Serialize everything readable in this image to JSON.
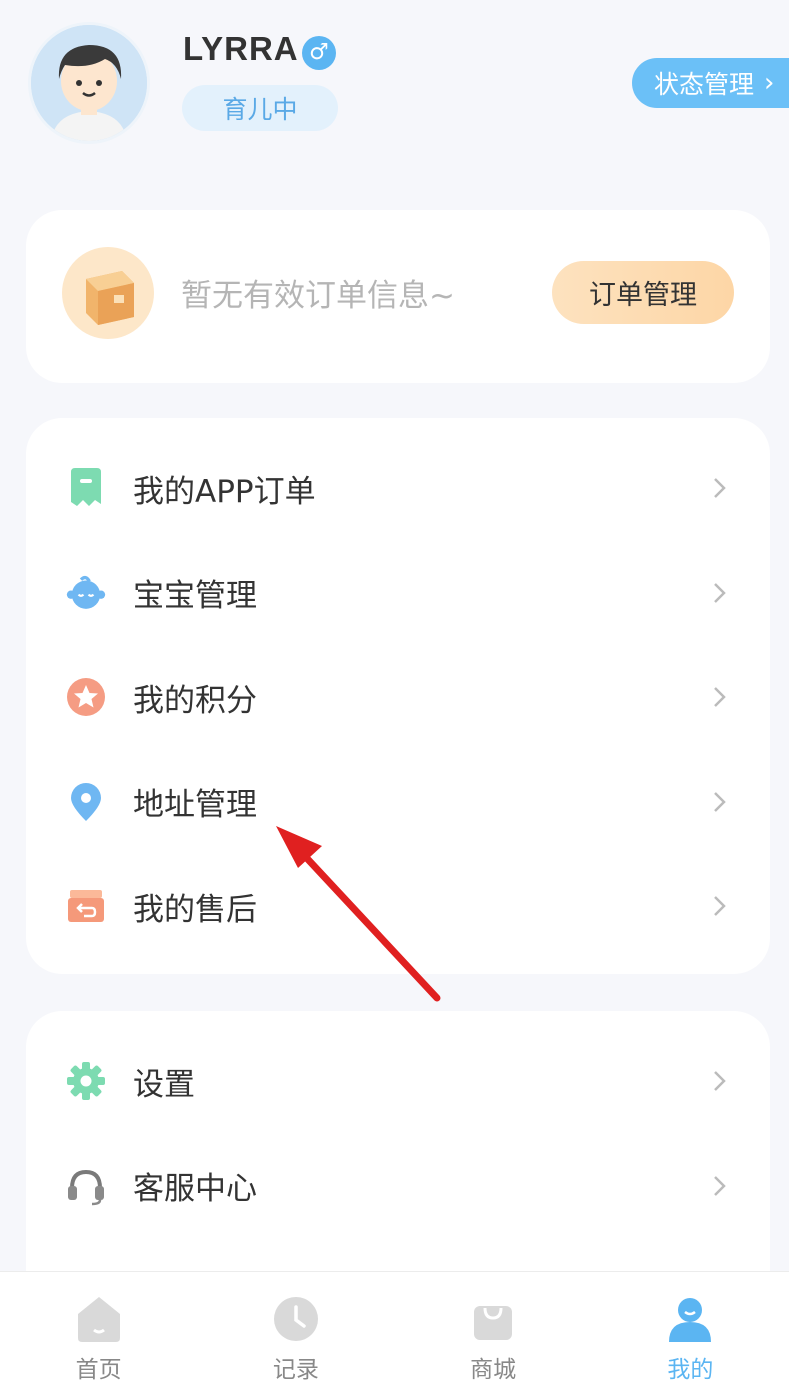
{
  "profile": {
    "username": "LYRRA",
    "gender_symbol": "♂",
    "status_badge": "育儿中",
    "state_button_label": "状态管理",
    "state_button_chevron": "›"
  },
  "order_card": {
    "empty_text": "暂无有效订单信息~",
    "manage_button": "订单管理"
  },
  "menu_group_1": [
    {
      "label": "我的APP订单",
      "icon": "order-receipt-icon"
    },
    {
      "label": "宝宝管理",
      "icon": "baby-face-icon"
    },
    {
      "label": "我的积分",
      "icon": "star-points-icon"
    },
    {
      "label": "地址管理",
      "icon": "location-pin-icon"
    },
    {
      "label": "我的售后",
      "icon": "return-box-icon"
    }
  ],
  "menu_group_2": [
    {
      "label": "设置",
      "icon": "gear-icon"
    },
    {
      "label": "客服中心",
      "icon": "headset-icon"
    }
  ],
  "tabbar": [
    {
      "label": "首页",
      "icon": "home-icon",
      "active": false
    },
    {
      "label": "记录",
      "icon": "clock-icon",
      "active": false
    },
    {
      "label": "商城",
      "icon": "shopping-bag-icon",
      "active": false
    },
    {
      "label": "我的",
      "icon": "user-icon",
      "active": true
    }
  ],
  "colors": {
    "accent": "#5bb5f2",
    "order_button": "#fdd6a6",
    "annotation_arrow": "#e02020"
  }
}
